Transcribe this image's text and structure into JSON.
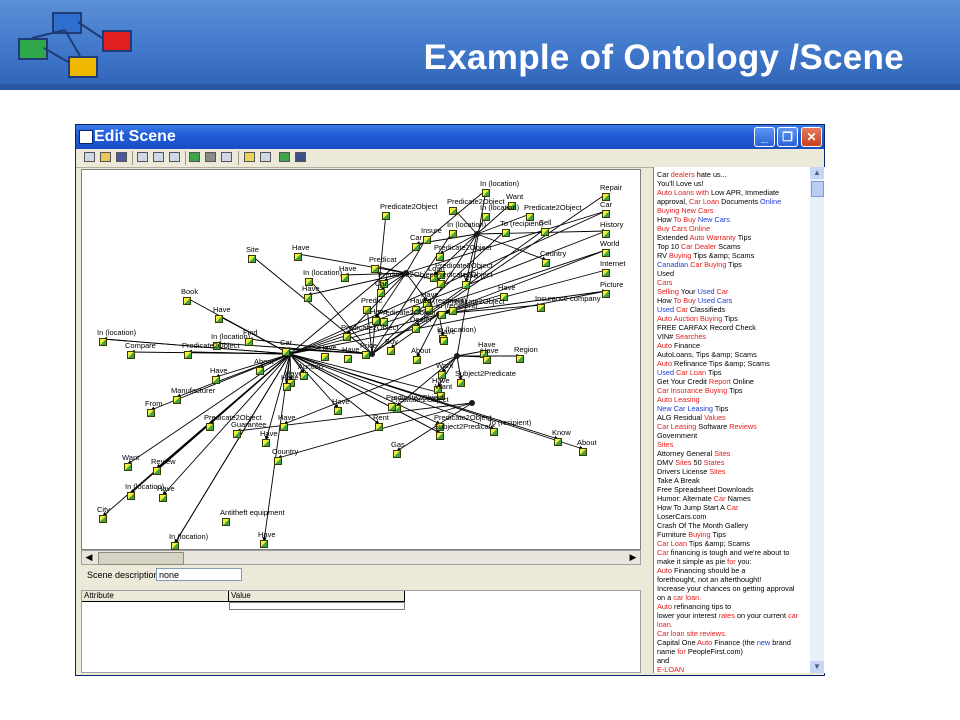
{
  "slide": {
    "title": "Example of Ontology /Scene",
    "header_color": "#3f76c9",
    "logo_colors": [
      "#2f6fd0",
      "#2ea84a",
      "#e02020",
      "#f0b800",
      "#7da93a"
    ]
  },
  "window": {
    "title": "Edit Scene",
    "controls": {
      "minimize": "_",
      "maximize": "❐",
      "close": "✕"
    },
    "toolbar_icons": [
      "new-icon",
      "open-icon",
      "save-icon",
      "tool-icon",
      "tool-icon",
      "tool-icon",
      "tool-icon",
      "tool-icon",
      "tool-icon",
      "tool-icon",
      "tool-icon",
      "check-icon",
      "person-icon"
    ]
  },
  "scene_description": {
    "label": "Scene description",
    "value": "none"
  },
  "attribute_table": {
    "headers": [
      "Attribute",
      "Value"
    ]
  },
  "graph": {
    "nodes": [
      {
        "label": "Repair"
      },
      {
        "label": "Car"
      },
      {
        "label": "History"
      },
      {
        "label": "World"
      },
      {
        "label": "Internet"
      },
      {
        "label": "Picture"
      },
      {
        "label": "In (location)"
      },
      {
        "label": "Want"
      },
      {
        "label": "Predicate2Object"
      },
      {
        "label": "In (location)"
      },
      {
        "label": "Predicate2Object"
      },
      {
        "label": "Sell"
      },
      {
        "label": "To (recipient)"
      },
      {
        "label": "In (location)"
      },
      {
        "label": "Insure"
      },
      {
        "label": "Predicate2Object"
      },
      {
        "label": "Car"
      },
      {
        "label": "Predicate2Object"
      },
      {
        "label": "Country"
      },
      {
        "label": "Site"
      },
      {
        "label": "Have"
      },
      {
        "label": "Predicat"
      },
      {
        "label": "Have"
      },
      {
        "label": "Predicate2Object"
      },
      {
        "label": "Have"
      },
      {
        "label": "Loan"
      },
      {
        "label": "In (location)"
      },
      {
        "label": "Have"
      },
      {
        "label": "Predicate2Object"
      },
      {
        "label": "Predicate2Object"
      },
      {
        "label": "Have"
      },
      {
        "label": "Book"
      },
      {
        "label": "Have"
      },
      {
        "label": "Car"
      },
      {
        "label": "Have"
      },
      {
        "label": "Predic"
      },
      {
        "label": "Haved"
      },
      {
        "label": "To (recipient)"
      },
      {
        "label": "Insurance company"
      },
      {
        "label": "Have"
      },
      {
        "label": "Predicate2Object"
      },
      {
        "label": "Predicate2Object"
      },
      {
        "label": "In (recipient)"
      },
      {
        "label": "In (location)"
      },
      {
        "label": "Predicate2Object"
      },
      {
        "label": "Dealer"
      },
      {
        "label": "In (location)"
      },
      {
        "label": "Find"
      },
      {
        "label": "In (location)"
      },
      {
        "label": "Have"
      },
      {
        "label": "Car"
      },
      {
        "label": "Compare"
      },
      {
        "label": "Predicate2Object"
      },
      {
        "label": "Price"
      },
      {
        "label": "Buy"
      },
      {
        "label": "Have"
      },
      {
        "label": "Have"
      },
      {
        "label": "Have"
      },
      {
        "label": "About"
      },
      {
        "label": "Region"
      },
      {
        "label": "Have"
      },
      {
        "label": "About"
      },
      {
        "label": "Want"
      },
      {
        "label": "Have"
      },
      {
        "label": "Have"
      },
      {
        "label": "Auction"
      },
      {
        "label": "Have"
      },
      {
        "label": "Subject2Predicate"
      },
      {
        "label": "Manufacturer"
      },
      {
        "label": "Have"
      },
      {
        "label": "Want"
      },
      {
        "label": "From"
      },
      {
        "label": "Predicate2Object"
      },
      {
        "label": "Have"
      },
      {
        "label": "Predicate2Object"
      },
      {
        "label": "Predicate2Object"
      },
      {
        "label": "Rent"
      },
      {
        "label": "Predicate2Object"
      },
      {
        "label": "Have"
      },
      {
        "label": "Have"
      },
      {
        "label": "To (recipient)"
      },
      {
        "label": "Guarantee"
      },
      {
        "label": "Subject2Predicate"
      },
      {
        "label": "Know"
      },
      {
        "label": "Gas"
      },
      {
        "label": "About"
      },
      {
        "label": "Country"
      },
      {
        "label": "Want"
      },
      {
        "label": "Review"
      },
      {
        "label": "In (location)"
      },
      {
        "label": "Have"
      },
      {
        "label": "Antitheft equipment"
      },
      {
        "label": "City"
      },
      {
        "label": "In (location)"
      },
      {
        "label": "Have"
      }
    ]
  },
  "text_lines": [
    [
      [
        "Car ",
        ""
      ],
      [
        "dealers",
        "r"
      ],
      [
        " hate us...",
        ""
      ]
    ],
    [
      [
        "You'll Love us!",
        ""
      ]
    ],
    [
      [
        "Auto Loans with",
        "r"
      ],
      [
        " Low APR, Immediate",
        ""
      ]
    ],
    [
      [
        "approval, ",
        ""
      ],
      [
        "Car Loan",
        "r"
      ],
      [
        " Documents ",
        ""
      ],
      [
        "Online",
        "b"
      ]
    ],
    [
      [
        "Buying New Cars",
        "r"
      ]
    ],
    [
      [
        "How ",
        ""
      ],
      [
        "To Buy",
        "r"
      ],
      [
        " ",
        ""
      ],
      [
        "New Cars",
        "b"
      ]
    ],
    [
      [
        "Buy Cars Online",
        "r"
      ]
    ],
    [
      [
        "Extended ",
        ""
      ],
      [
        "Auto Warranty",
        "r"
      ],
      [
        " Tips",
        ""
      ]
    ],
    [
      [
        "Top 10 ",
        ""
      ],
      [
        "Car Dealer",
        "r"
      ],
      [
        " Scams",
        ""
      ]
    ],
    [
      [
        "RV ",
        ""
      ],
      [
        "Buying",
        "r"
      ],
      [
        " Tips &amp; Scams",
        ""
      ]
    ],
    [
      [
        "Canadian",
        "b"
      ],
      [
        " ",
        ""
      ],
      [
        "Car Buying",
        "r"
      ],
      [
        " Tips",
        ""
      ]
    ],
    [
      [
        "Used",
        ""
      ]
    ],
    [
      [
        "Cars",
        "r"
      ]
    ],
    [
      [
        "Selling",
        "r"
      ],
      [
        " Your ",
        ""
      ],
      [
        "Used",
        "b"
      ],
      [
        " ",
        ""
      ],
      [
        "Car",
        "r"
      ]
    ],
    [
      [
        "How ",
        ""
      ],
      [
        "To Buy",
        "r"
      ],
      [
        " ",
        ""
      ],
      [
        "Used Cars",
        "b"
      ]
    ],
    [
      [
        "Used",
        "b"
      ],
      [
        " ",
        ""
      ],
      [
        "Car",
        "r"
      ],
      [
        " Classifieds",
        ""
      ]
    ],
    [
      [
        "Auto Auction Buying",
        "r"
      ],
      [
        " Tips",
        ""
      ]
    ],
    [
      [
        "FREE CARFAX Record Check",
        ""
      ]
    ],
    [
      [
        "VIN# ",
        ""
      ],
      [
        "Searches",
        "r"
      ]
    ],
    [
      [
        "Auto",
        "r"
      ],
      [
        " Finance",
        ""
      ]
    ],
    [
      [
        "AutoLoans, Tips &amp; Scams",
        ""
      ]
    ],
    [
      [
        "Auto",
        "r"
      ],
      [
        " Refinance Tips &amp; Scams",
        ""
      ]
    ],
    [
      [
        "Used",
        "b"
      ],
      [
        " ",
        ""
      ],
      [
        "Car Loan",
        "r"
      ],
      [
        " Tips",
        ""
      ]
    ],
    [
      [
        "Get Your Credit ",
        ""
      ],
      [
        "Report",
        "r"
      ],
      [
        " Online",
        ""
      ]
    ],
    [
      [
        "Car Insurance Buying",
        "r"
      ],
      [
        " Tips",
        ""
      ]
    ],
    [
      [
        "Auto Leasing",
        "r"
      ]
    ],
    [
      [
        "New Car Leasing",
        "b"
      ],
      [
        " Tips",
        ""
      ]
    ],
    [
      [
        "ALG Residual ",
        ""
      ],
      [
        "Values",
        "r"
      ]
    ],
    [
      [
        "Car Leasing",
        "r"
      ],
      [
        " Software ",
        ""
      ],
      [
        "Reviews",
        "r"
      ]
    ],
    [
      [
        "Government",
        ""
      ]
    ],
    [
      [
        "Sites",
        "r"
      ]
    ],
    [
      [
        "Attorney General ",
        ""
      ],
      [
        "Sites",
        "r"
      ]
    ],
    [
      [
        "DMV ",
        ""
      ],
      [
        "Sites",
        "r"
      ],
      [
        " 50 ",
        ""
      ],
      [
        "States",
        "r"
      ]
    ],
    [
      [
        "Drivers License ",
        ""
      ],
      [
        "Sites",
        "r"
      ]
    ],
    [
      [
        "Take A Break",
        ""
      ]
    ],
    [
      [
        "Free Spreadsheet Downloads",
        ""
      ]
    ],
    [
      [
        "Humor: Alternate ",
        ""
      ],
      [
        "Car",
        "r"
      ],
      [
        " Names",
        ""
      ]
    ],
    [
      [
        "How To Jump Start A ",
        ""
      ],
      [
        "Car",
        "r"
      ]
    ],
    [
      [
        "LoserCars.com",
        ""
      ]
    ],
    [
      [
        "Crash Of The Month Gallery",
        ""
      ]
    ],
    [
      [
        "Furniture ",
        ""
      ],
      [
        "Buying",
        "r"
      ],
      [
        " Tips",
        ""
      ]
    ],
    [
      [
        "Car Loan",
        "r"
      ],
      [
        " Tips &amp; Scams",
        ""
      ]
    ],
    [
      [
        "Car",
        "r"
      ],
      [
        " financing is tough and we're about to",
        ""
      ]
    ],
    [
      [
        "make it simple as pie ",
        ""
      ],
      [
        "for",
        "r"
      ],
      [
        " you:",
        ""
      ]
    ],
    [
      [
        "Auto",
        "r"
      ],
      [
        " Financing should be a",
        ""
      ]
    ],
    [
      [
        "forethought, not an afterthought!",
        ""
      ]
    ],
    [
      [
        "Increase your chances on getting approval",
        ""
      ]
    ],
    [
      [
        "on a ",
        ""
      ],
      [
        "car loan.",
        "r"
      ]
    ],
    [
      [
        "Auto",
        "r"
      ],
      [
        " refinancing tips to",
        ""
      ]
    ],
    [
      [
        "lower your interest ",
        ""
      ],
      [
        "rates",
        "r"
      ],
      [
        " on your current ",
        ""
      ],
      [
        "car",
        "r"
      ]
    ],
    [
      [
        "loan.",
        "r"
      ]
    ],
    [
      [
        "Car loan site reviews.",
        "r"
      ]
    ],
    [
      [
        "Capital One ",
        ""
      ],
      [
        "Auto",
        "r"
      ],
      [
        " Finance (the ",
        ""
      ],
      [
        "new",
        "b"
      ],
      [
        " brand",
        ""
      ]
    ],
    [
      [
        "name ",
        ""
      ],
      [
        "for",
        "r"
      ],
      [
        " PeopleFirst.com)",
        ""
      ]
    ],
    [
      [
        "and",
        ""
      ]
    ],
    [
      [
        "E-LOAN",
        "r"
      ]
    ]
  ]
}
